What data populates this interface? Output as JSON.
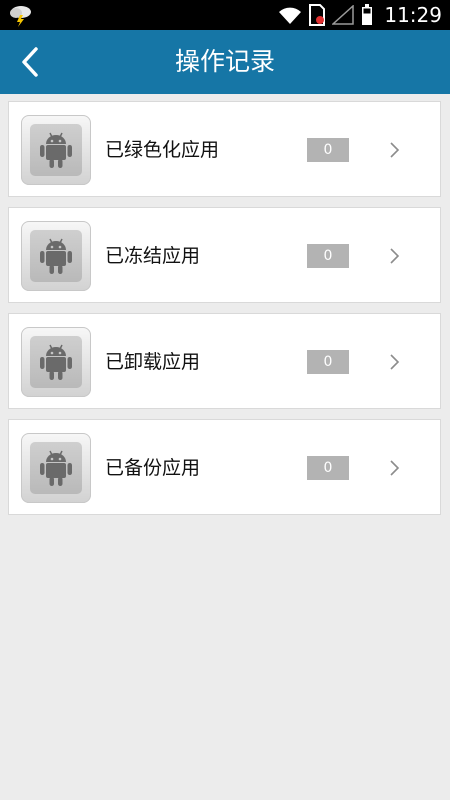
{
  "status_bar": {
    "time": "11:29",
    "icons": [
      "weather-icon",
      "wifi-icon",
      "sim-icon",
      "signal-icon",
      "battery-icon"
    ]
  },
  "header": {
    "title": "操作记录",
    "back_icon": "chevron-left-icon"
  },
  "records": [
    {
      "label": "已绿色化应用",
      "count": "0",
      "icon": "android-icon"
    },
    {
      "label": "已冻结应用",
      "count": "0",
      "icon": "android-icon"
    },
    {
      "label": "已卸载应用",
      "count": "0",
      "icon": "android-icon"
    },
    {
      "label": "已备份应用",
      "count": "0",
      "icon": "android-icon"
    }
  ],
  "colors": {
    "header_bg": "#1676a6",
    "page_bg": "#ececec",
    "badge_bg": "#b3b3b3"
  }
}
